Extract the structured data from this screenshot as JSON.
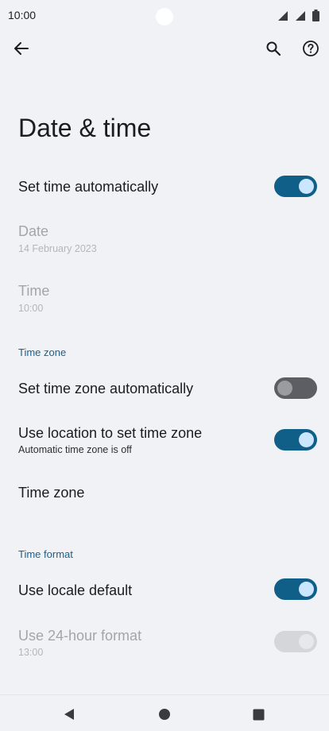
{
  "status_bar": {
    "time": "10:00",
    "icons": [
      "signal-icon",
      "signal-icon",
      "battery-icon"
    ]
  },
  "app_bar": {
    "icons": [
      "back-arrow-icon",
      "search-icon",
      "help-icon"
    ]
  },
  "page": {
    "title": "Date & time"
  },
  "settings": {
    "set_time_auto": {
      "label": "Set time automatically",
      "enabled": true
    },
    "date": {
      "label": "Date",
      "value": "14 February 2023"
    },
    "time": {
      "label": "Time",
      "value": "10:00"
    },
    "time_zone_header": "Time zone",
    "set_tz_auto": {
      "label": "Set time zone automatically",
      "enabled": false
    },
    "use_location": {
      "label": "Use location to set time zone",
      "summary": "Automatic time zone is off",
      "enabled": true
    },
    "time_zone": {
      "label": "Time zone"
    },
    "time_format_header": "Time format",
    "locale_default": {
      "label": "Use locale default",
      "enabled": true
    },
    "use_24h": {
      "label": "Use 24-hour format",
      "value": "13:00",
      "enabled": true,
      "disabled": true
    }
  },
  "colors": {
    "accent": "#0f5f88",
    "section_header": "#1d5f86",
    "background": "#f1f2f5"
  },
  "nav_bar": {
    "icons": [
      "back-triangle-icon",
      "home-circle-icon",
      "recents-square-icon"
    ]
  }
}
